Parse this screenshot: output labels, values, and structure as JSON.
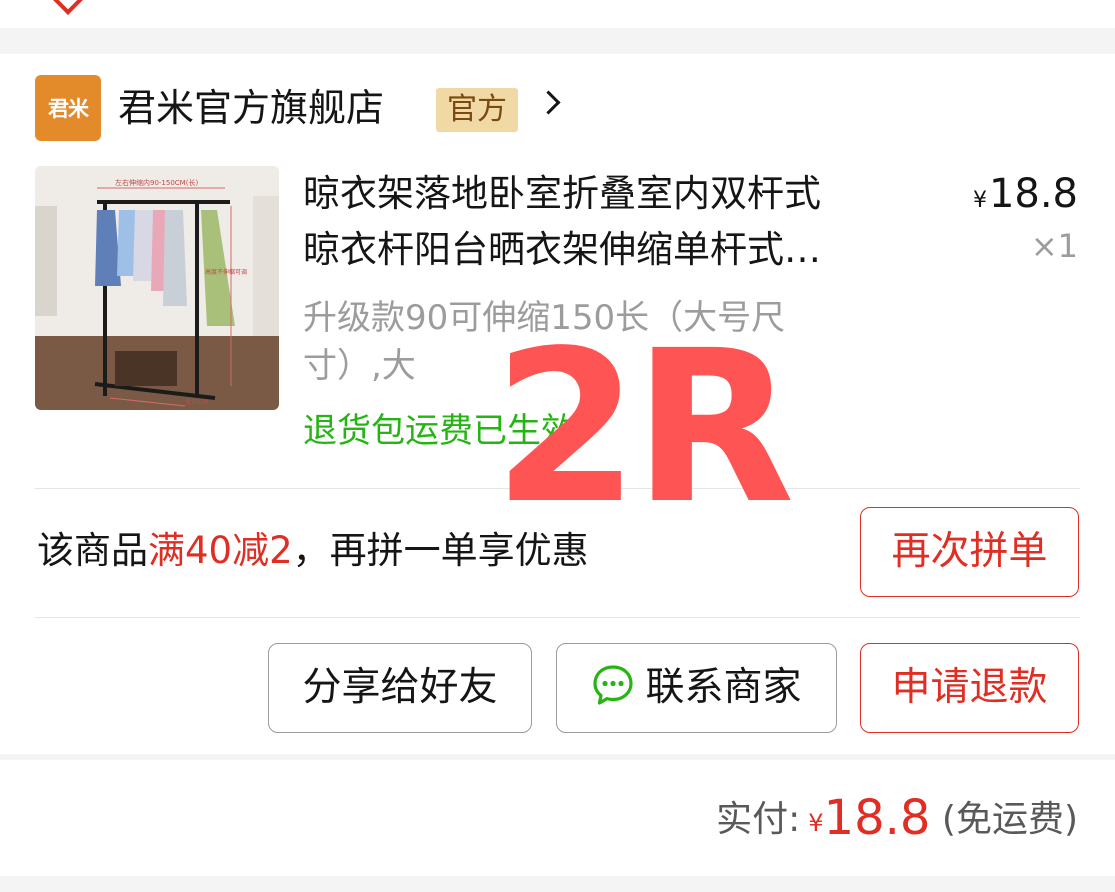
{
  "shop": {
    "logo_text": "君米",
    "name": "君米官方旗舰店",
    "badge": "官方"
  },
  "goods": {
    "title_line1": "晾衣架落地卧室折叠室内双杆式",
    "title_line2": "晾衣杆阳台晒衣架伸缩单杆式…",
    "price_symbol": "¥",
    "price": "18.8",
    "quantity": "×1",
    "spec_line1": "升级款90可伸缩150长（大号尺",
    "spec_line2": "寸）,大",
    "return_note": "退货包运费已生效"
  },
  "thumbnail": {
    "dim_top": "左右伸缩内90-150CM(长)",
    "dim_side": "高度不伸缩可调",
    "dim_bottom": "宽33CM"
  },
  "promo": {
    "prefix": "该商品",
    "highlight": "满40减2",
    "suffix": "，再拼一单享优惠",
    "button": "再次拼单"
  },
  "actions": {
    "share": "分享给好友",
    "contact": "联系商家",
    "refund": "申请退款"
  },
  "payment": {
    "label": "实付:",
    "currency": "¥",
    "amount": "18.8",
    "shipping_note": "(免运费)"
  },
  "overlay_label": "2R",
  "colors": {
    "accent_red": "#e02e24",
    "green": "#25b513",
    "logo_orange": "#e38a2b",
    "badge_gold": "#f1d9a6",
    "overlay": "#ff5454"
  },
  "icons": [
    "chevron-right-icon",
    "chat-bubble-icon"
  ]
}
